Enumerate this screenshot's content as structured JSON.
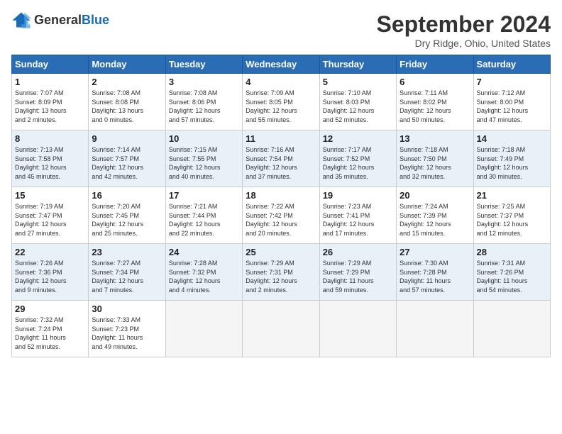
{
  "header": {
    "logo_general": "General",
    "logo_blue": "Blue",
    "title": "September 2024",
    "location": "Dry Ridge, Ohio, United States"
  },
  "weekdays": [
    "Sunday",
    "Monday",
    "Tuesday",
    "Wednesday",
    "Thursday",
    "Friday",
    "Saturday"
  ],
  "weeks": [
    [
      {
        "day": "1",
        "lines": [
          "Sunrise: 7:07 AM",
          "Sunset: 8:09 PM",
          "Daylight: 13 hours",
          "and 2 minutes."
        ]
      },
      {
        "day": "2",
        "lines": [
          "Sunrise: 7:08 AM",
          "Sunset: 8:08 PM",
          "Daylight: 13 hours",
          "and 0 minutes."
        ]
      },
      {
        "day": "3",
        "lines": [
          "Sunrise: 7:08 AM",
          "Sunset: 8:06 PM",
          "Daylight: 12 hours",
          "and 57 minutes."
        ]
      },
      {
        "day": "4",
        "lines": [
          "Sunrise: 7:09 AM",
          "Sunset: 8:05 PM",
          "Daylight: 12 hours",
          "and 55 minutes."
        ]
      },
      {
        "day": "5",
        "lines": [
          "Sunrise: 7:10 AM",
          "Sunset: 8:03 PM",
          "Daylight: 12 hours",
          "and 52 minutes."
        ]
      },
      {
        "day": "6",
        "lines": [
          "Sunrise: 7:11 AM",
          "Sunset: 8:02 PM",
          "Daylight: 12 hours",
          "and 50 minutes."
        ]
      },
      {
        "day": "7",
        "lines": [
          "Sunrise: 7:12 AM",
          "Sunset: 8:00 PM",
          "Daylight: 12 hours",
          "and 47 minutes."
        ]
      }
    ],
    [
      {
        "day": "8",
        "lines": [
          "Sunrise: 7:13 AM",
          "Sunset: 7:58 PM",
          "Daylight: 12 hours",
          "and 45 minutes."
        ]
      },
      {
        "day": "9",
        "lines": [
          "Sunrise: 7:14 AM",
          "Sunset: 7:57 PM",
          "Daylight: 12 hours",
          "and 42 minutes."
        ]
      },
      {
        "day": "10",
        "lines": [
          "Sunrise: 7:15 AM",
          "Sunset: 7:55 PM",
          "Daylight: 12 hours",
          "and 40 minutes."
        ]
      },
      {
        "day": "11",
        "lines": [
          "Sunrise: 7:16 AM",
          "Sunset: 7:54 PM",
          "Daylight: 12 hours",
          "and 37 minutes."
        ]
      },
      {
        "day": "12",
        "lines": [
          "Sunrise: 7:17 AM",
          "Sunset: 7:52 PM",
          "Daylight: 12 hours",
          "and 35 minutes."
        ]
      },
      {
        "day": "13",
        "lines": [
          "Sunrise: 7:18 AM",
          "Sunset: 7:50 PM",
          "Daylight: 12 hours",
          "and 32 minutes."
        ]
      },
      {
        "day": "14",
        "lines": [
          "Sunrise: 7:18 AM",
          "Sunset: 7:49 PM",
          "Daylight: 12 hours",
          "and 30 minutes."
        ]
      }
    ],
    [
      {
        "day": "15",
        "lines": [
          "Sunrise: 7:19 AM",
          "Sunset: 7:47 PM",
          "Daylight: 12 hours",
          "and 27 minutes."
        ]
      },
      {
        "day": "16",
        "lines": [
          "Sunrise: 7:20 AM",
          "Sunset: 7:45 PM",
          "Daylight: 12 hours",
          "and 25 minutes."
        ]
      },
      {
        "day": "17",
        "lines": [
          "Sunrise: 7:21 AM",
          "Sunset: 7:44 PM",
          "Daylight: 12 hours",
          "and 22 minutes."
        ]
      },
      {
        "day": "18",
        "lines": [
          "Sunrise: 7:22 AM",
          "Sunset: 7:42 PM",
          "Daylight: 12 hours",
          "and 20 minutes."
        ]
      },
      {
        "day": "19",
        "lines": [
          "Sunrise: 7:23 AM",
          "Sunset: 7:41 PM",
          "Daylight: 12 hours",
          "and 17 minutes."
        ]
      },
      {
        "day": "20",
        "lines": [
          "Sunrise: 7:24 AM",
          "Sunset: 7:39 PM",
          "Daylight: 12 hours",
          "and 15 minutes."
        ]
      },
      {
        "day": "21",
        "lines": [
          "Sunrise: 7:25 AM",
          "Sunset: 7:37 PM",
          "Daylight: 12 hours",
          "and 12 minutes."
        ]
      }
    ],
    [
      {
        "day": "22",
        "lines": [
          "Sunrise: 7:26 AM",
          "Sunset: 7:36 PM",
          "Daylight: 12 hours",
          "and 9 minutes."
        ]
      },
      {
        "day": "23",
        "lines": [
          "Sunrise: 7:27 AM",
          "Sunset: 7:34 PM",
          "Daylight: 12 hours",
          "and 7 minutes."
        ]
      },
      {
        "day": "24",
        "lines": [
          "Sunrise: 7:28 AM",
          "Sunset: 7:32 PM",
          "Daylight: 12 hours",
          "and 4 minutes."
        ]
      },
      {
        "day": "25",
        "lines": [
          "Sunrise: 7:29 AM",
          "Sunset: 7:31 PM",
          "Daylight: 12 hours",
          "and 2 minutes."
        ]
      },
      {
        "day": "26",
        "lines": [
          "Sunrise: 7:29 AM",
          "Sunset: 7:29 PM",
          "Daylight: 11 hours",
          "and 59 minutes."
        ]
      },
      {
        "day": "27",
        "lines": [
          "Sunrise: 7:30 AM",
          "Sunset: 7:28 PM",
          "Daylight: 11 hours",
          "and 57 minutes."
        ]
      },
      {
        "day": "28",
        "lines": [
          "Sunrise: 7:31 AM",
          "Sunset: 7:26 PM",
          "Daylight: 11 hours",
          "and 54 minutes."
        ]
      }
    ],
    [
      {
        "day": "29",
        "lines": [
          "Sunrise: 7:32 AM",
          "Sunset: 7:24 PM",
          "Daylight: 11 hours",
          "and 52 minutes."
        ]
      },
      {
        "day": "30",
        "lines": [
          "Sunrise: 7:33 AM",
          "Sunset: 7:23 PM",
          "Daylight: 11 hours",
          "and 49 minutes."
        ]
      },
      null,
      null,
      null,
      null,
      null
    ]
  ]
}
